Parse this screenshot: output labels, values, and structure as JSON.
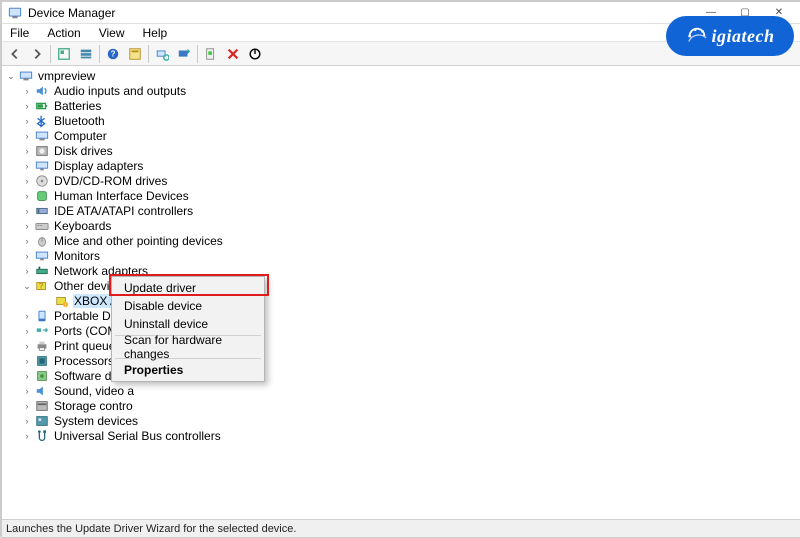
{
  "window": {
    "title": "Device Manager"
  },
  "win_buttons": {
    "min": "—",
    "max": "▢",
    "close": "✕"
  },
  "menus": [
    "File",
    "Action",
    "View",
    "Help"
  ],
  "root_node": "vmpreview",
  "categories": [
    "Audio inputs and outputs",
    "Batteries",
    "Bluetooth",
    "Computer",
    "Disk drives",
    "Display adapters",
    "DVD/CD-ROM drives",
    "Human Interface Devices",
    "IDE ATA/ATAPI controllers",
    "Keyboards",
    "Mice and other pointing devices",
    "Monitors",
    "Network adapters",
    "Other devices",
    "Portable Devices",
    "Ports (COM & LPT)",
    "Print queues",
    "Processors",
    "Software devices",
    "Sound, video and game controllers",
    "Storage controllers",
    "System devices",
    "Universal Serial Bus controllers"
  ],
  "categories_truncated": [
    "Audio inputs and outputs",
    "Batteries",
    "Bluetooth",
    "Computer",
    "Disk drives",
    "Display adapters",
    "DVD/CD-ROM drives",
    "Human Interface Devices",
    "IDE ATA/ATAPI controllers",
    "Keyboards",
    "Mice and other pointing devices",
    "Monitors",
    "Network adapters"
  ],
  "expanded_category": "Other devices",
  "expanded_child": "XBOX ACC",
  "categories_after": [
    "Portable Devi",
    "Ports (COM &",
    "Print queues",
    "Processors",
    "Software devic",
    "Sound, video a",
    "Storage contro",
    "System devices",
    "Universal Serial Bus controllers"
  ],
  "context_menu": {
    "update": "Update driver",
    "disable": "Disable device",
    "uninstall": "Uninstall device",
    "scan": "Scan for hardware changes",
    "properties": "Properties"
  },
  "statusbar": "Launches the Update Driver Wizard for the selected device.",
  "logo_text": "igiatech"
}
